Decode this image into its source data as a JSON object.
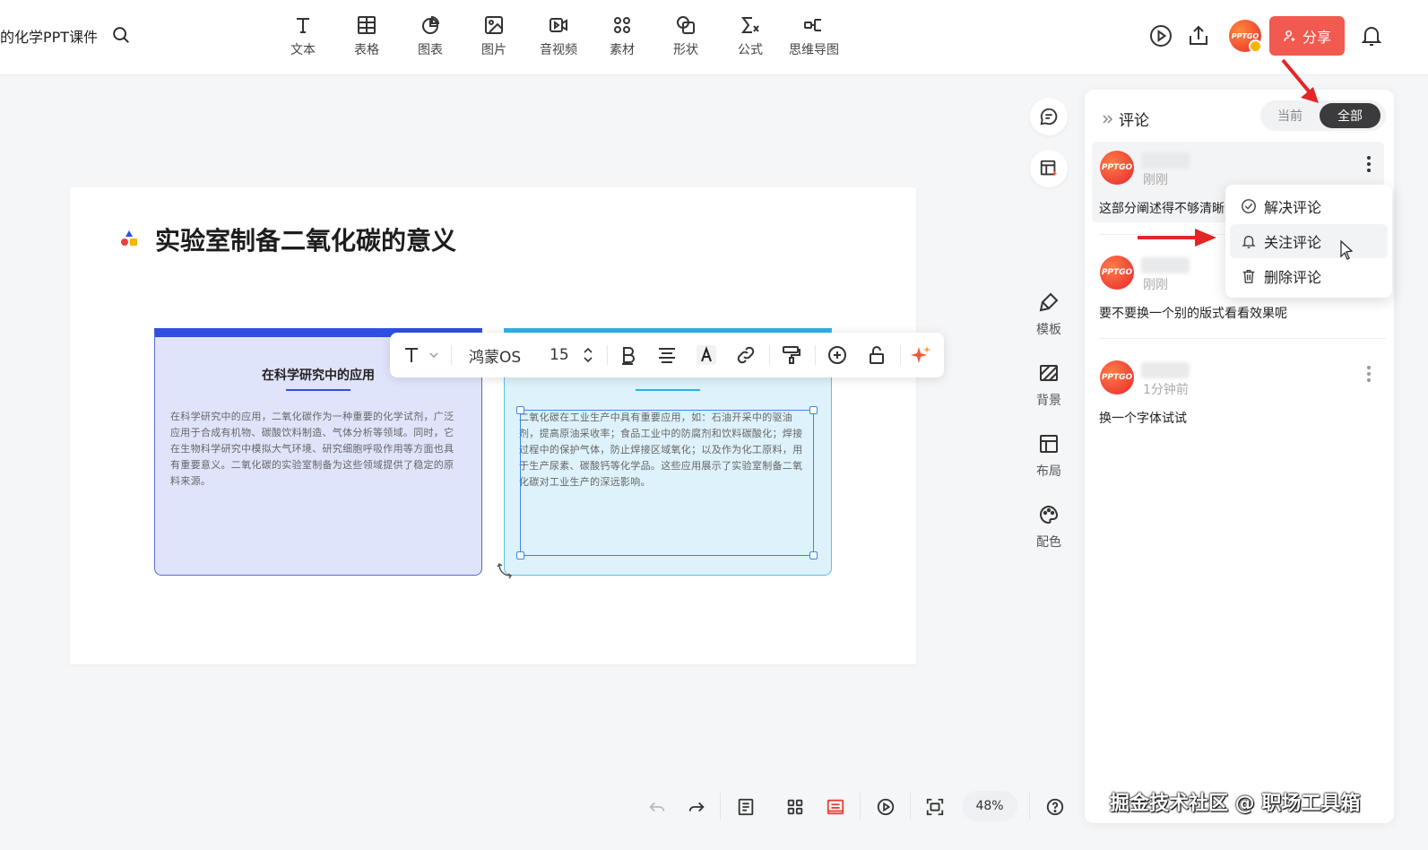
{
  "header": {
    "doc_title": "的化学PPT课件",
    "tools": [
      {
        "label": "文本",
        "icon": "text-icon"
      },
      {
        "label": "表格",
        "icon": "table-icon"
      },
      {
        "label": "图表",
        "icon": "chart-icon"
      },
      {
        "label": "图片",
        "icon": "image-icon"
      },
      {
        "label": "音视频",
        "icon": "video-icon"
      },
      {
        "label": "素材",
        "icon": "assets-icon"
      },
      {
        "label": "形状",
        "icon": "shape-icon"
      },
      {
        "label": "公式",
        "icon": "formula-icon"
      },
      {
        "label": "思维导图",
        "icon": "mindmap-icon"
      }
    ],
    "avatar_text": "PPTGO",
    "share_label": "分享"
  },
  "slide": {
    "title": "实验室制备二氧化碳的意义",
    "card1": {
      "heading": "在科学研究中的应用",
      "body": "在科学研究中的应用，二氧化碳作为一种重要的化学试剂，广泛应用于合成有机物、碳酸饮料制造、气体分析等领域。同时，它在生物科学研究中模拟大气环境、研究细胞呼吸作用等方面也具有重要意义。二氧化碳的实验室制备为这些领域提供了稳定的原料来源。"
    },
    "card2": {
      "body": "二氧化碳在工业生产中具有重要应用，如：石油开采中的驱油剂，提高原油采收率；食品工业中的防腐剂和饮料碳酸化；焊接过程中的保护气体，防止焊接区域氧化；以及作为化工原料，用于生产尿素、碳酸钙等化学品。这些应用展示了实验室制备二氧化碳对工业生产的深远影响。"
    },
    "colors": {
      "card1_accent": "#2f4fe0",
      "card2_accent": "#2cb2e4"
    }
  },
  "text_toolbar": {
    "font": "鸿蒙OS",
    "size": "15"
  },
  "side_tools": [
    {
      "label": "模板",
      "icon": "template-icon"
    },
    {
      "label": "背景",
      "icon": "background-icon"
    },
    {
      "label": "布局",
      "icon": "layout-icon"
    },
    {
      "label": "配色",
      "icon": "palette-icon"
    }
  ],
  "comments_panel": {
    "title": "评论",
    "tab_current": "当前",
    "tab_all": "全部",
    "comments": [
      {
        "avatar": "PPTGO",
        "time": "刚刚",
        "text": "这部分阐述得不够清晰"
      },
      {
        "avatar": "PPTGO",
        "time": "刚刚",
        "text": "要不要换一个别的版式看看效果呢"
      },
      {
        "avatar": "PPTGO",
        "time": "1分钟前",
        "text": "换一个字体试试"
      }
    ]
  },
  "comment_menu": {
    "items": [
      "解决评论",
      "关注评论",
      "删除评论"
    ],
    "hovered": "关注评论"
  },
  "bottom_bar": {
    "zoom": "48%"
  },
  "watermark": "掘金技术社区 @ 职场工具箱"
}
